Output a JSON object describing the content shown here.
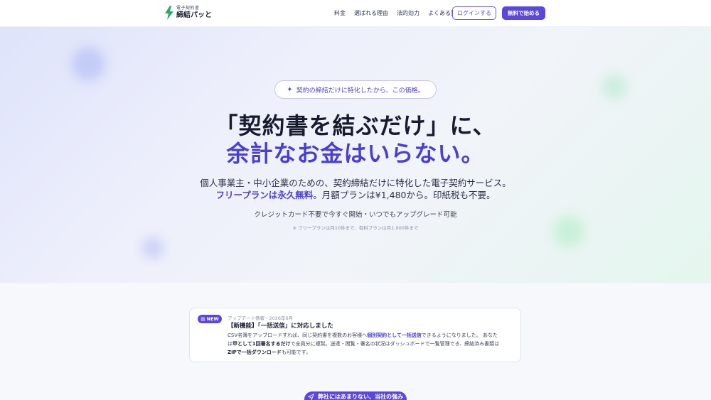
{
  "header": {
    "logo_sub": "電子契約書",
    "logo_main": "締結パッと",
    "nav": [
      "料金",
      "選ばれる理由",
      "法的効力",
      "よくある質問"
    ],
    "login": "ログインする",
    "start": "無料で始める"
  },
  "hero": {
    "badge": "契約の締結だけに特化したから、この価格。",
    "headline_1": "「契約書を結ぶだけ」に、",
    "headline_2": "余計なお金はいらない。",
    "lead_1": "個人事業主・中小企業のための、契約締結だけに特化した電子契約サービス。",
    "lead_2_highlight": "フリープランは永久無料",
    "lead_2_rest": "。月額プランは¥1,480から。印紙税も不要。",
    "note_1": "クレジットカード不要で今すぐ開始・いつでもアップグレード可能",
    "note_2": "※ フリープランは月10件まで、有料プランは月1,000件まで"
  },
  "update": {
    "badge": "NEW",
    "meta": "アップデート情報・2026年6月",
    "title": "【新機能】「一括送信」に対応しました",
    "body_1": "CSV名簿をアップロードすれば、同じ契約書を複数のお客様へ",
    "body_1_accent": "個別契約として一括送信",
    "body_1_rest": "できるようになりました。 あなた",
    "body_2_pre": "は",
    "body_2_b1": "甲として1回署名するだけ",
    "body_2_rest": "で全員分に複製。送達・閲覧・署名の状況はダッシュボードで一覧管理でき、締結済み書類は",
    "body_3_b": "ZIPで一括ダウンロード",
    "body_3_rest": "も可能です。"
  },
  "bottom": {
    "label": "弊社にはあまりない、当社の強み"
  },
  "colors": {
    "accent": "#5a47db",
    "accent_text": "#4a3fd0",
    "logo_bolt": "#2ea66b"
  }
}
